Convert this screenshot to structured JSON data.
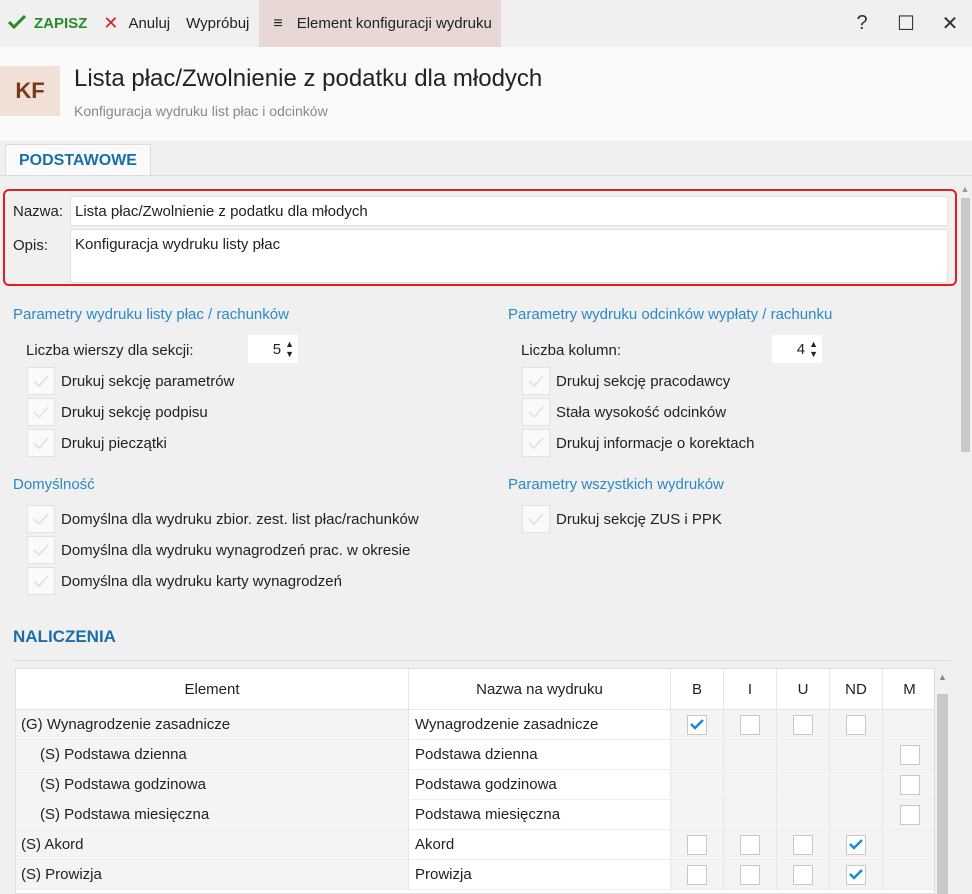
{
  "toolbar": {
    "save_label": "ZAPISZ",
    "cancel_label": "Anuluj",
    "try_label": "Wypróbuj",
    "menu_label": "Element konfiguracji wydruku",
    "help_label": "?",
    "maximize_label": "☐",
    "close_label": "✕"
  },
  "header": {
    "badge": "KF",
    "title": "Lista płac/Zwolnienie z podatku dla młodych",
    "subtitle": "Konfiguracja wydruku list płac i odcinków"
  },
  "tabs": [
    {
      "label": "PODSTAWOWE"
    }
  ],
  "form": {
    "name_label": "Nazwa:",
    "name_value": "Lista płac/Zwolnienie z podatku dla młodych",
    "desc_label": "Opis:",
    "desc_value": "Konfiguracja wydruku listy płac"
  },
  "left_params": {
    "title": "Parametry wydruku listy płac / rachunków",
    "rows_label": "Liczba wierszy dla sekcji:",
    "rows_value": "5",
    "checks": [
      {
        "label": "Drukuj sekcję parametrów"
      },
      {
        "label": "Drukuj sekcję podpisu"
      },
      {
        "label": "Drukuj pieczątki"
      }
    ]
  },
  "right_params": {
    "title": "Parametry wydruku odcinków wypłaty / rachunku",
    "cols_label": "Liczba kolumn:",
    "cols_value": "4",
    "checks": [
      {
        "label": "Drukuj sekcję pracodawcy"
      },
      {
        "label": "Stała wysokość odcinków"
      },
      {
        "label": "Drukuj informacje o korektach"
      }
    ]
  },
  "defaults": {
    "title": "Domyślność",
    "checks": [
      {
        "label": "Domyślna dla wydruku zbior. zest. list płac/rachunków"
      },
      {
        "label": "Domyślna dla wydruku wynagrodzeń prac. w okresie"
      },
      {
        "label": "Domyślna dla wydruku karty wynagrodzeń"
      }
    ]
  },
  "all_params": {
    "title": "Parametry wszystkich wydruków",
    "checks": [
      {
        "label": "Drukuj sekcję ZUS i PPK"
      }
    ]
  },
  "naliczenia": {
    "title": "NALICZENIA",
    "headers": [
      "Element",
      "Nazwa na wydruku",
      "B",
      "I",
      "U",
      "ND",
      "M"
    ],
    "rows": [
      {
        "element": "(G) Wynagrodzenie zasadnicze",
        "name": "Wynagrodzenie zasadnicze",
        "B": true,
        "I": false,
        "U": false,
        "ND": false,
        "M": null
      },
      {
        "element": "(S) Podstawa dzienna",
        "name": "Podstawa dzienna",
        "B": null,
        "I": null,
        "U": null,
        "ND": null,
        "M": false
      },
      {
        "element": "(S) Podstawa godzinowa",
        "name": "Podstawa godzinowa",
        "B": null,
        "I": null,
        "U": null,
        "ND": null,
        "M": false
      },
      {
        "element": "(S) Podstawa miesięczna",
        "name": "Podstawa miesięczna",
        "B": null,
        "I": null,
        "U": null,
        "ND": null,
        "M": false
      },
      {
        "element": "(S) Akord",
        "name": "Akord",
        "B": false,
        "I": false,
        "U": false,
        "ND": true,
        "M": null
      },
      {
        "element": "(S) Prowizja",
        "name": "Prowizja",
        "B": false,
        "I": false,
        "U": false,
        "ND": true,
        "M": null
      }
    ]
  },
  "colors": {
    "accent": "#1a6fa8",
    "section_title": "#2a8ac4",
    "save_green": "#2a8a2a",
    "cancel_red": "#d42020",
    "highlight_red": "#e02020",
    "check_blue": "#1a8ad4"
  }
}
